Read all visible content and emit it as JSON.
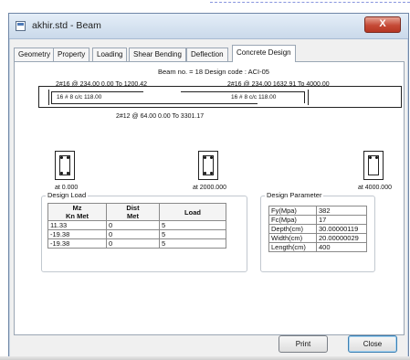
{
  "window": {
    "title": "akhir.std - Beam",
    "close_label": "X"
  },
  "tabs": [
    {
      "label": "Geometry"
    },
    {
      "label": "Property"
    },
    {
      "label": "Loading"
    },
    {
      "label": "Shear Bending"
    },
    {
      "label": "Deflection"
    },
    {
      "label": "Concrete Design",
      "active": true
    }
  ],
  "beam": {
    "header": "Beam no. = 18  Design code :  ACI-05",
    "top_left_bar": "2#16 @ 234.00 0.00 To 1200.42",
    "top_right_bar": "2#16 @ 234.00 1632.91 To 4000.00",
    "stirrup_left": "16 # 8 c/c 118.00",
    "stirrup_right": "16 # 8 c/c 118.00",
    "bottom_bar": "2#12 @ 64.00 0.00 To 3301.17",
    "sections": [
      {
        "label": "at 0.000"
      },
      {
        "label": "at 2000.000"
      },
      {
        "label": "at 4000.000"
      }
    ]
  },
  "design_load": {
    "title": "Design Load",
    "headers": {
      "mz": "Mz",
      "mz_unit": "Kn Met",
      "dist": "Dist",
      "dist_unit": "Met",
      "load": "Load"
    },
    "rows": [
      {
        "mz": "11.33",
        "dist": "0",
        "load": "5"
      },
      {
        "mz": "-19.38",
        "dist": "0",
        "load": "5"
      },
      {
        "mz": "-19.38",
        "dist": "0",
        "load": "5"
      }
    ]
  },
  "design_parameter": {
    "title": "Design Parameter",
    "rows": [
      {
        "name": "Fy(Mpa)",
        "value": "382"
      },
      {
        "name": "Fc(Mpa)",
        "value": "17"
      },
      {
        "name": "Depth(cm)",
        "value": "30.00000119"
      },
      {
        "name": "Width(cm)",
        "value": "20.00000029"
      },
      {
        "name": "Length(cm)",
        "value": "400"
      }
    ]
  },
  "buttons": {
    "print": "Print",
    "close": "Close"
  }
}
